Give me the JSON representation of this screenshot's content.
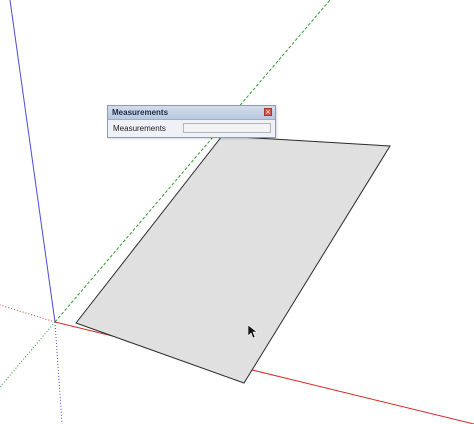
{
  "measurements": {
    "title": "Measurements",
    "label": "Measurements",
    "value": "",
    "close_glyph": "×"
  },
  "colors": {
    "axis_red": "#d22a2a",
    "axis_green": "#2f9a2f",
    "axis_blue": "#4b4bd9",
    "face": "#e0e0e0",
    "edge": "#2b2b2b"
  },
  "icons": {
    "cursor": "arrow-cursor-icon",
    "close": "close-icon"
  }
}
